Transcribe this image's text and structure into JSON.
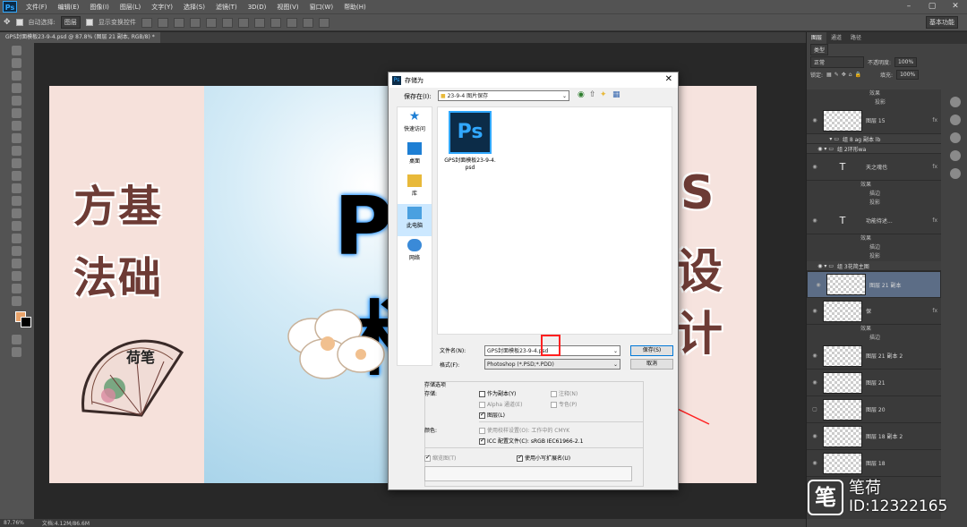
{
  "menubar": {
    "logo": "Ps",
    "items": [
      "文件(F)",
      "编辑(E)",
      "图像(I)",
      "图层(L)",
      "文字(Y)",
      "选择(S)",
      "滤镜(T)",
      "3D(D)",
      "视图(V)",
      "窗口(W)",
      "帮助(H)"
    ]
  },
  "optbar": {
    "auto_select_label": "自动选择:",
    "auto_select_value": "图层",
    "show_transform_label": "显示变换控件",
    "workspace_value": "基本功能"
  },
  "doctab": {
    "label": "GPS封面模板23-9-4.psd @ 87.8% (图层 21 副本, RGB/8) *"
  },
  "artwork": {
    "left_text_1": "方基",
    "left_text_2": "法础",
    "fan_text": "荷笔",
    "mid_text_1": "P",
    "mid_text_2": "术",
    "right_text_1": "S",
    "right_text_2": "设",
    "right_text_3": "计"
  },
  "statusbar": {
    "zoom": "87.76%",
    "doc": "文档:4.12M/86.6M"
  },
  "panels": {
    "tabs": [
      "图层",
      "通道",
      "路径"
    ],
    "kind_label": "类型",
    "blend_mode": "正常",
    "opacity_label": "不透明度:",
    "opacity_value": "100%",
    "lock_label": "锁定:",
    "fill_label": "填充:",
    "fill_value": "100%",
    "layers": [
      {
        "type": "sub",
        "text": "效果"
      },
      {
        "type": "sub",
        "text": "投影"
      },
      {
        "type": "layer",
        "name": "图层 15",
        "fx": "fx"
      },
      {
        "type": "group",
        "name": "组 8 ag 副本 lb"
      },
      {
        "type": "group",
        "name": "组 2环形wa"
      },
      {
        "type": "text",
        "name": "天之魂也",
        "fx": "fx"
      },
      {
        "type": "sub",
        "text": "效果"
      },
      {
        "type": "sub",
        "text": "描边"
      },
      {
        "type": "sub",
        "text": "投影"
      },
      {
        "type": "text",
        "name": "功能待述...",
        "fx": "fx"
      },
      {
        "type": "sub",
        "text": "效果"
      },
      {
        "type": "sub",
        "text": "描边"
      },
      {
        "type": "sub",
        "text": "投影"
      },
      {
        "type": "group",
        "name": "组 3花简主图"
      },
      {
        "type": "layer",
        "name": "图层 21 副本",
        "selected": true
      },
      {
        "type": "layer",
        "name": "保",
        "fx": "fx"
      },
      {
        "type": "sub",
        "text": "效果"
      },
      {
        "type": "sub",
        "text": "描边"
      },
      {
        "type": "layer",
        "name": "图层 21 副本 2"
      },
      {
        "type": "layer",
        "name": "图层 21"
      },
      {
        "type": "layer",
        "name": "图层 20"
      },
      {
        "type": "layer",
        "name": "图层 18 副本 2"
      },
      {
        "type": "layer",
        "name": "图层 18"
      }
    ]
  },
  "dialog": {
    "title": "存储为",
    "save_in_label": "保存在(I):",
    "save_in_value": "23-9-4 图片保存",
    "places": [
      "快速访问",
      "桌面",
      "库",
      "此电脑",
      "网络"
    ],
    "file_name": "GPS封面模板23-9-4.psd",
    "file_label": "GPS封面模板23-9-4.psd",
    "filename_label": "文件名(N):",
    "filename_value": "GPS封面模板23-9-4.psd",
    "format_label": "格式(F):",
    "format_value": "Photoshop (*.PSD;*.PDD)",
    "save_button": "保存(S)",
    "cancel_button": "取消",
    "options_title": "存储选项",
    "store_label": "存储:",
    "as_copy": "作为副本(Y)",
    "notes": "注释(N)",
    "alpha": "Alpha 通道(E)",
    "spot": "专色(P)",
    "layers_opt": "图层(L)",
    "color_label": "颜色:",
    "proof": "使用校样设置(O):",
    "proof_value": "工作中的 CMYK",
    "icc": "ICC 配置文件(C):",
    "icc_value": "sRGB IEC61966-2.1",
    "thumbnail": "缩览图(T)",
    "lowercase": "使用小写扩展名(U)"
  },
  "watermark": {
    "brand": "笔荷",
    "id": "ID:12322165"
  },
  "colors": {
    "accent": "#31a8ff",
    "annotation": "#ff2020"
  }
}
